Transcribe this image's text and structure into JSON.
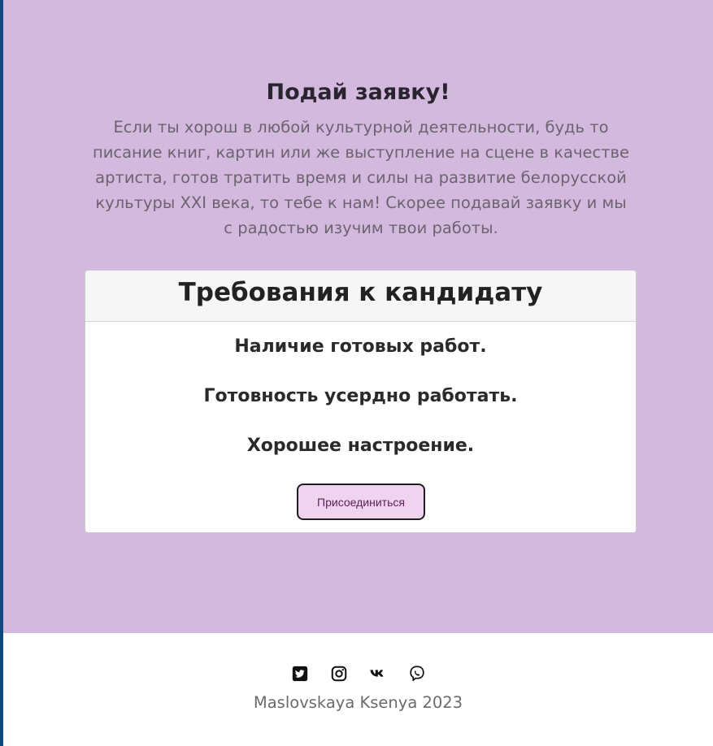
{
  "hero": {
    "title": "Подай заявку!",
    "description": "Если ты хорош в любой культурной деятельности, будь то писание книг, картин или же выступление на сцене в качестве артиста, готов тратить время и силы на развитие белорусской культуры XXI века, то тебе к нам! Скорее подавай заявку и мы с радостью изучим твои работы."
  },
  "card": {
    "title": "Требования к кандидату",
    "requirements": [
      "Наличие готовых работ.",
      "Готовность усердно работать.",
      "Хорошее настроение."
    ],
    "button_label": "Присоединиться"
  },
  "footer": {
    "social_icons": [
      "twitter-icon",
      "instagram-icon",
      "vk-icon",
      "viber-icon"
    ],
    "copyright": "Maslovskaya Ksenya 2023"
  },
  "colors": {
    "background": "#d4b9de",
    "button_background": "#efd3ef",
    "button_text": "#5a1f5a"
  }
}
